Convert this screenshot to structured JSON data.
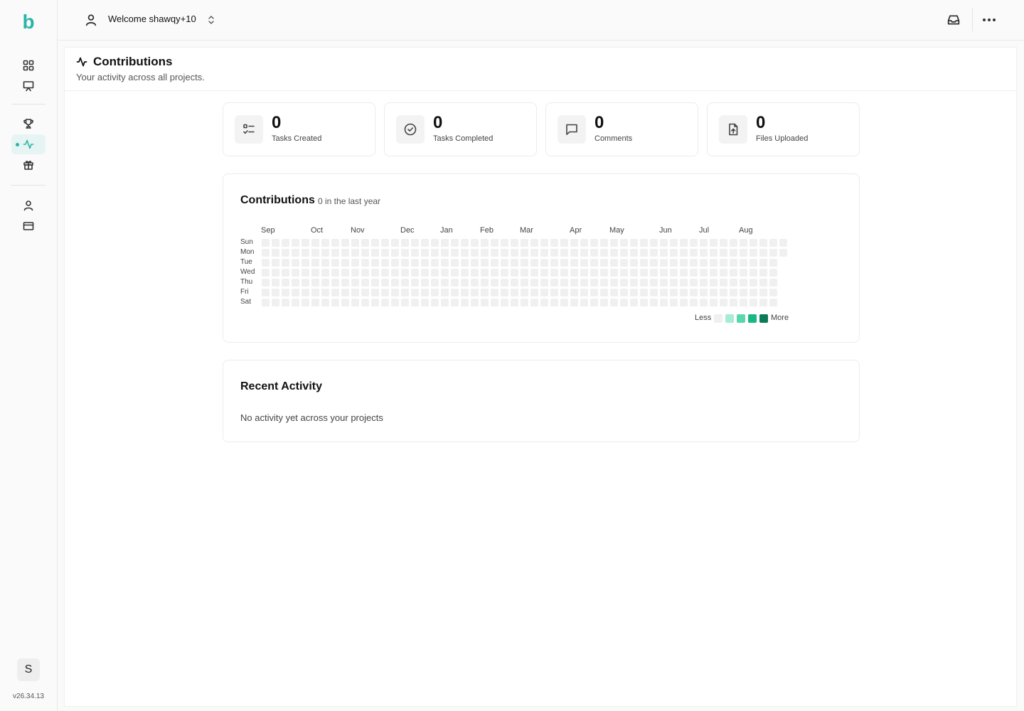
{
  "app": {
    "logo_letter": "b",
    "version": "v26.34.13",
    "user_initial": "S",
    "accent_color": "#2bb5a8"
  },
  "header": {
    "welcome": "Welcome shawqy+10",
    "icons": [
      "user-icon",
      "chevron-updown-icon",
      "inbox-icon",
      "more-icon"
    ]
  },
  "sidebar": {
    "items": [
      {
        "id": "dashboard",
        "icon": "grid-icon"
      },
      {
        "id": "presentation",
        "icon": "presentation-icon"
      },
      {
        "id": "trophy",
        "icon": "trophy-icon"
      },
      {
        "id": "contributions",
        "icon": "activity-icon",
        "active": true
      },
      {
        "id": "gift",
        "icon": "gift-icon"
      },
      {
        "id": "profile",
        "icon": "user-icon"
      },
      {
        "id": "billing",
        "icon": "credit-card-icon"
      }
    ]
  },
  "page": {
    "title": "Contributions",
    "subtitle": "Your activity across all projects."
  },
  "stats": [
    {
      "value": "0",
      "label": "Tasks Created",
      "icon": "checklist-icon"
    },
    {
      "value": "0",
      "label": "Tasks Completed",
      "icon": "check-circle-icon"
    },
    {
      "value": "0",
      "label": "Comments",
      "icon": "message-icon"
    },
    {
      "value": "0",
      "label": "Files Uploaded",
      "icon": "file-upload-icon"
    }
  ],
  "contributions": {
    "title": "Contributions",
    "count_text": "0 in the last year",
    "months": [
      "Sep",
      "Oct",
      "Nov",
      "Dec",
      "Jan",
      "Feb",
      "Mar",
      "Apr",
      "May",
      "Jun",
      "Jul",
      "Aug"
    ],
    "days": [
      "Sun",
      "Mon",
      "Tue",
      "Wed",
      "Thu",
      "Fri",
      "Sat"
    ],
    "weeks": 53,
    "legend_less": "Less",
    "legend_more": "More",
    "level_colors": [
      "#f0f0f0",
      "#a7ecd4",
      "#5ad7ad",
      "#17b886",
      "#0b7a57"
    ]
  },
  "activity": {
    "title": "Recent Activity",
    "empty_text": "No activity yet across your projects"
  }
}
